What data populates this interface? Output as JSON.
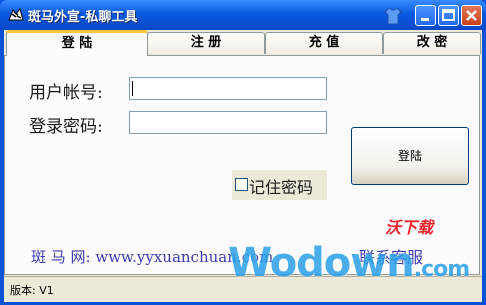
{
  "window": {
    "title": "斑马外宣-私聊工具"
  },
  "tabs": [
    {
      "label": "登  陆"
    },
    {
      "label": "注  册"
    },
    {
      "label": "充  值"
    },
    {
      "label": "改  密"
    }
  ],
  "login": {
    "account_label": "用户帐号:",
    "account_value": "",
    "password_label": "登录密码:",
    "password_value": "",
    "login_button": "登陆",
    "remember_label": "记住密码",
    "remember_checked": false
  },
  "footer": {
    "site_label": "斑  马  网:",
    "site_url": "www.yyxuanchuan.com",
    "service_link": "联系客服"
  },
  "status": {
    "version": "版本: V1"
  },
  "watermark": {
    "top": "沃下载",
    "main": "Wodown",
    "suffix": ".com"
  }
}
